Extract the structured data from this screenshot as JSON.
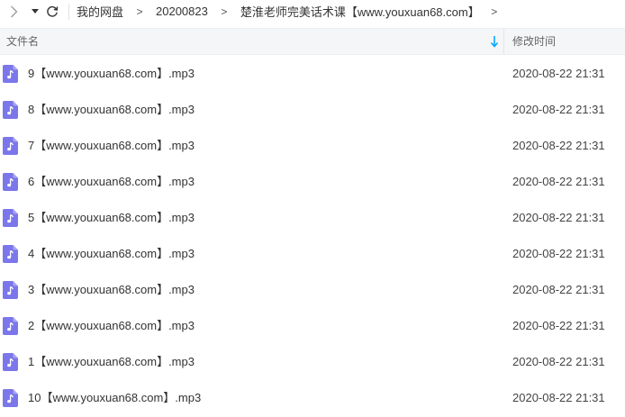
{
  "colors": {
    "accent": "#06a7ff",
    "file_icon": "#7b77ea",
    "header_bg": "#f5f6f8"
  },
  "nav": {
    "forward_icon": "chevron-right-icon",
    "dropdown_icon": "triangle-down-icon",
    "refresh_icon": "refresh-icon"
  },
  "breadcrumb": {
    "items": [
      {
        "label": "我的网盘"
      },
      {
        "label": "20200823"
      },
      {
        "label": "楚淮老师完美话术课【www.youxuan68.com】"
      }
    ],
    "separator": ">"
  },
  "columns": {
    "name": "文件名",
    "time": "修改时间",
    "sort_icon": "sort-down-arrow-icon"
  },
  "files": [
    {
      "name": "9【www.youxuan68.com】.mp3",
      "modified": "2020-08-22 21:31",
      "icon": "audio-file-icon"
    },
    {
      "name": "8【www.youxuan68.com】.mp3",
      "modified": "2020-08-22 21:31",
      "icon": "audio-file-icon"
    },
    {
      "name": "7【www.youxuan68.com】.mp3",
      "modified": "2020-08-22 21:31",
      "icon": "audio-file-icon"
    },
    {
      "name": "6【www.youxuan68.com】.mp3",
      "modified": "2020-08-22 21:31",
      "icon": "audio-file-icon"
    },
    {
      "name": "5【www.youxuan68.com】.mp3",
      "modified": "2020-08-22 21:31",
      "icon": "audio-file-icon"
    },
    {
      "name": "4【www.youxuan68.com】.mp3",
      "modified": "2020-08-22 21:31",
      "icon": "audio-file-icon"
    },
    {
      "name": "3【www.youxuan68.com】.mp3",
      "modified": "2020-08-22 21:31",
      "icon": "audio-file-icon"
    },
    {
      "name": "2【www.youxuan68.com】.mp3",
      "modified": "2020-08-22 21:31",
      "icon": "audio-file-icon"
    },
    {
      "name": "1【www.youxuan68.com】.mp3",
      "modified": "2020-08-22 21:31",
      "icon": "audio-file-icon"
    },
    {
      "name": "10【www.youxuan68.com】.mp3",
      "modified": "2020-08-22 21:31",
      "icon": "audio-file-icon"
    }
  ]
}
